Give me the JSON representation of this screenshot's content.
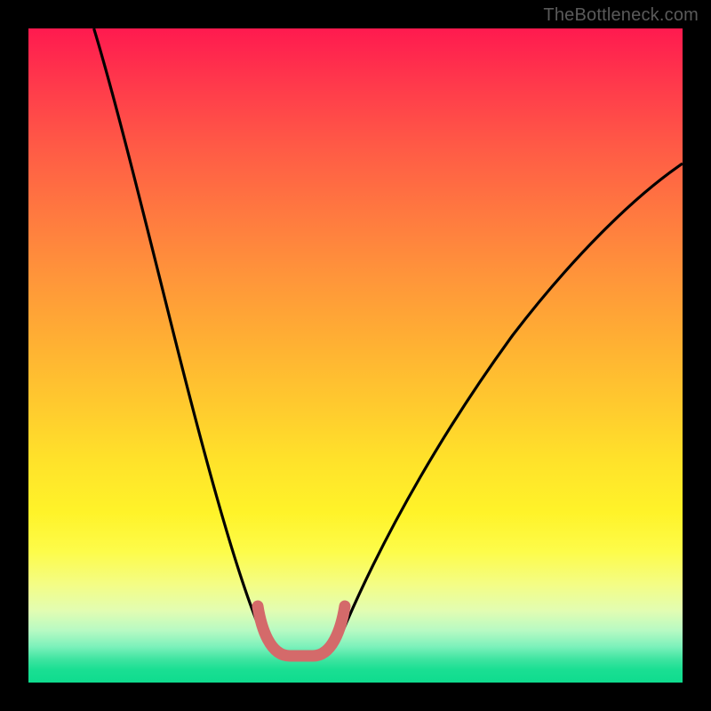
{
  "watermark": "TheBottleneck.com",
  "colors": {
    "frame": "#000000",
    "curve": "#000000",
    "marker": "#d46a6a",
    "gradient_top": "#ff1a4f",
    "gradient_bottom": "#0fdc8e"
  },
  "chart_data": {
    "type": "line",
    "title": "",
    "xlabel": "",
    "ylabel": "",
    "xlim": [
      0,
      100
    ],
    "ylim": [
      0,
      100
    ],
    "grid": false,
    "legend": false,
    "description": "Bottleneck curve: a single V-shaped black profile on a vertical rainbow gradient (red top → green bottom). The minimum sits around x≈40 at y≈4. A short thick pink U-shaped marker highlights the bottom of the V between x≈35 and x≈47.",
    "series": [
      {
        "name": "bottleneck-curve",
        "x": [
          10,
          12,
          14,
          16,
          18,
          20,
          22,
          24,
          26,
          28,
          30,
          32.5,
          34,
          36,
          38,
          40,
          42,
          44,
          46,
          48,
          50,
          55,
          60,
          65,
          70,
          75,
          80,
          85,
          90,
          95,
          100
        ],
        "y": [
          100,
          92,
          84,
          76,
          68,
          60,
          52,
          45,
          38,
          31,
          25,
          19,
          14,
          9,
          6,
          4,
          4.5,
          6,
          9,
          12,
          16,
          24,
          31,
          37.5,
          43,
          48,
          52.5,
          56.5,
          60,
          63,
          66
        ]
      },
      {
        "name": "min-marker",
        "x": [
          35,
          36.5,
          38,
          40,
          42,
          44,
          45.5,
          47
        ],
        "y": [
          12,
          8,
          5,
          4,
          4,
          5,
          8,
          12
        ]
      }
    ]
  }
}
